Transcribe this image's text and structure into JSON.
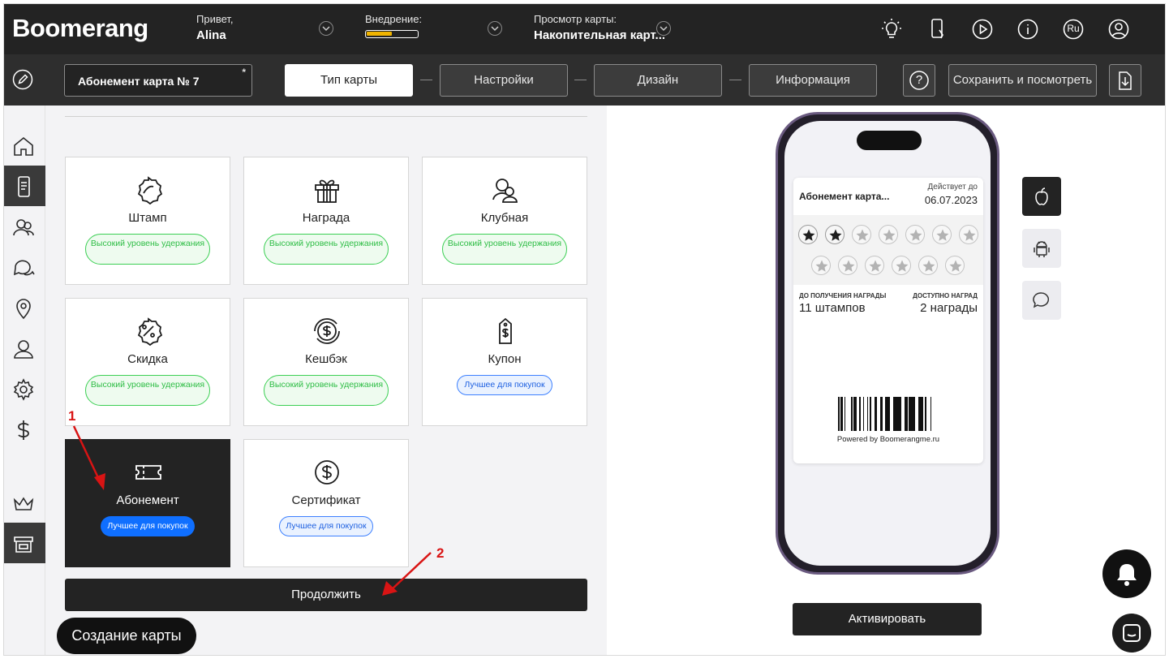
{
  "header": {
    "logo": "Boomerang",
    "greeting_label": "Привет,",
    "user_name": "Alina",
    "implementation_label": "Внедрение:",
    "implementation_progress_pct": 50,
    "view_label": "Просмотр карты:",
    "view_value": "Накопительная карт...",
    "icons": [
      "lightbulb-icon",
      "phone-icon",
      "play-icon",
      "info-icon",
      "language-icon",
      "user-icon"
    ],
    "language": "Ru"
  },
  "toolbar": {
    "card_name": "Абонемент карта № 7",
    "required_mark": "*",
    "steps": [
      "Тип карты",
      "Настройки",
      "Дизайн",
      "Информация"
    ],
    "active_step": 0,
    "help_symbol": "?",
    "save_label": "Сохранить и посмотреть"
  },
  "sidebar": {
    "items": [
      "home",
      "cards",
      "clients",
      "messages",
      "locations",
      "profile",
      "settings",
      "billing",
      "crown",
      "store"
    ],
    "active": "cards"
  },
  "card_types": [
    {
      "name": "Штамп",
      "badge": "Высокий уровень удержания",
      "badge_style": "green",
      "icon": "stamp-icon",
      "selected": false
    },
    {
      "name": "Награда",
      "badge": "Высокий уровень удержания",
      "badge_style": "green",
      "icon": "gift-icon",
      "selected": false
    },
    {
      "name": "Клубная",
      "badge": "Высокий уровень удержания",
      "badge_style": "green",
      "icon": "club-icon",
      "selected": false
    },
    {
      "name": "Скидка",
      "badge": "Высокий уровень удержания",
      "badge_style": "green",
      "icon": "discount-icon",
      "selected": false
    },
    {
      "name": "Кешбэк",
      "badge": "Высокий уровень удержания",
      "badge_style": "green",
      "icon": "cashback-icon",
      "selected": false
    },
    {
      "name": "Купон",
      "badge": "Лучшее для покупок",
      "badge_style": "blue",
      "icon": "coupon-icon",
      "selected": false
    },
    {
      "name": "Абонемент",
      "badge": "Лучшее для покупок",
      "badge_style": "blue-filled",
      "icon": "ticket-icon",
      "selected": true
    },
    {
      "name": "Сертификат",
      "badge": "Лучшее для покупок",
      "badge_style": "blue",
      "icon": "certificate-icon",
      "selected": false
    }
  ],
  "continue_label": "Продолжить",
  "create_card_label": "Создание карты",
  "annotations": [
    "1",
    "2"
  ],
  "preview": {
    "card_title": "Абонемент карта...",
    "valid_label": "Действует до",
    "valid_date": "06.07.2023",
    "stamps_total": 13,
    "stamps_filled": 2,
    "left_label": "ДО ПОЛУЧЕНИЯ НАГРАДЫ",
    "left_value": "11 штампов",
    "right_label": "ДОСТУПНО НАГРАД",
    "right_value": "2 награды",
    "powered_by": "Powered by Boomerangme.ru",
    "os_buttons": [
      "apple-icon",
      "android-icon",
      "chat-bubble-icon"
    ],
    "activate_label": "Активировать"
  },
  "colors": {
    "dark": "#232323",
    "green_badge": "#2ebd45",
    "blue_badge": "#1c5fe0",
    "blue_filled": "#0f6fff",
    "annotation": "#d91414",
    "progress": "#f0b400"
  }
}
